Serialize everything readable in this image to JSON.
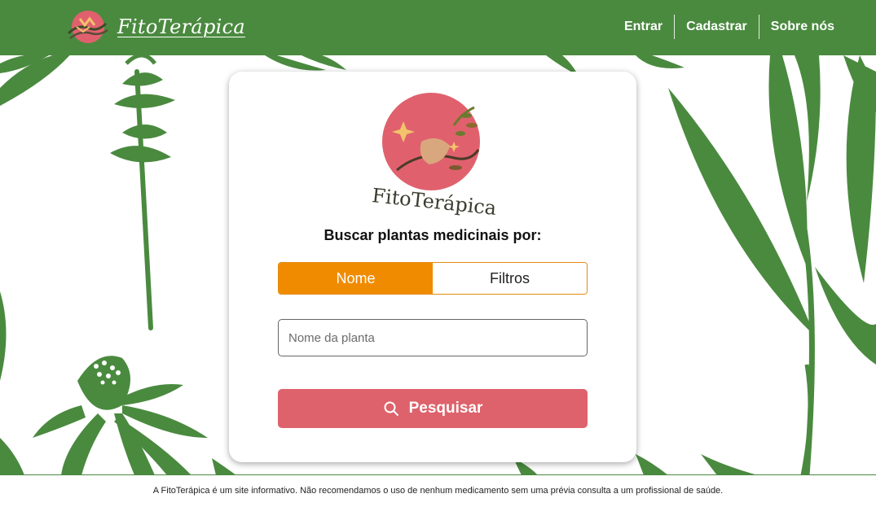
{
  "header": {
    "brand_name": "FitoTerápica",
    "brand_logo_icon": "herbal-hand-logo-icon",
    "nav": [
      {
        "label": "Entrar"
      },
      {
        "label": "Cadastrar"
      },
      {
        "label": "Sobre nós"
      }
    ]
  },
  "card": {
    "logo_icon": "fitoterapica-circle-logo-icon",
    "logo_text": "FitoTerápica",
    "title": "Buscar plantas medicinais por:",
    "tabs": [
      {
        "label": "Nome",
        "active": true
      },
      {
        "label": "Filtros",
        "active": false
      }
    ],
    "search_placeholder": "Nome da planta",
    "search_value": "",
    "search_button_label": "Pesquisar",
    "search_button_icon": "search-icon"
  },
  "footer": {
    "text": "A FitoTerápica é um site informativo. Não recomendamos o uso de nenhum medicamento sem uma prévia consulta a um profissional de saúde."
  },
  "colors": {
    "header_bg": "#4a8a3f",
    "leaf_green": "#4a8a3f",
    "tab_active": "#f08b00",
    "search_button": "#de626b",
    "logo_circle": "#e0616d"
  }
}
